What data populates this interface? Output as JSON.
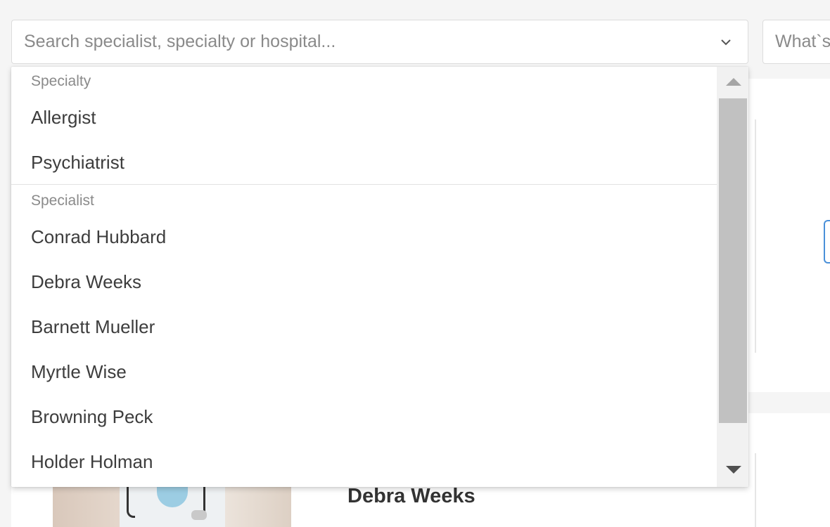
{
  "search": {
    "placeholder": "Search specialist, specialty or hospital...",
    "toggle_icon": "chevron-down-icon"
  },
  "secondary_search": {
    "placeholder": "What`s"
  },
  "dropdown": {
    "groups": [
      {
        "header": "Specialty",
        "options": [
          "Allergist",
          "Psychiatrist"
        ]
      },
      {
        "header": "Specialist",
        "options": [
          "Conrad Hubbard",
          "Debra Weeks",
          "Barnett Mueller",
          "Myrtle Wise",
          "Browning Peck",
          "Holder Holman"
        ]
      }
    ],
    "scroll_up_icon": "triangle-up-icon",
    "scroll_down_icon": "triangle-down-icon"
  },
  "result_card": {
    "doctor_name": "Debra Weeks"
  },
  "colors": {
    "background": "#f5f5f5",
    "accent": "#4a90d9",
    "scroll_thumb": "#c1c1c1"
  }
}
